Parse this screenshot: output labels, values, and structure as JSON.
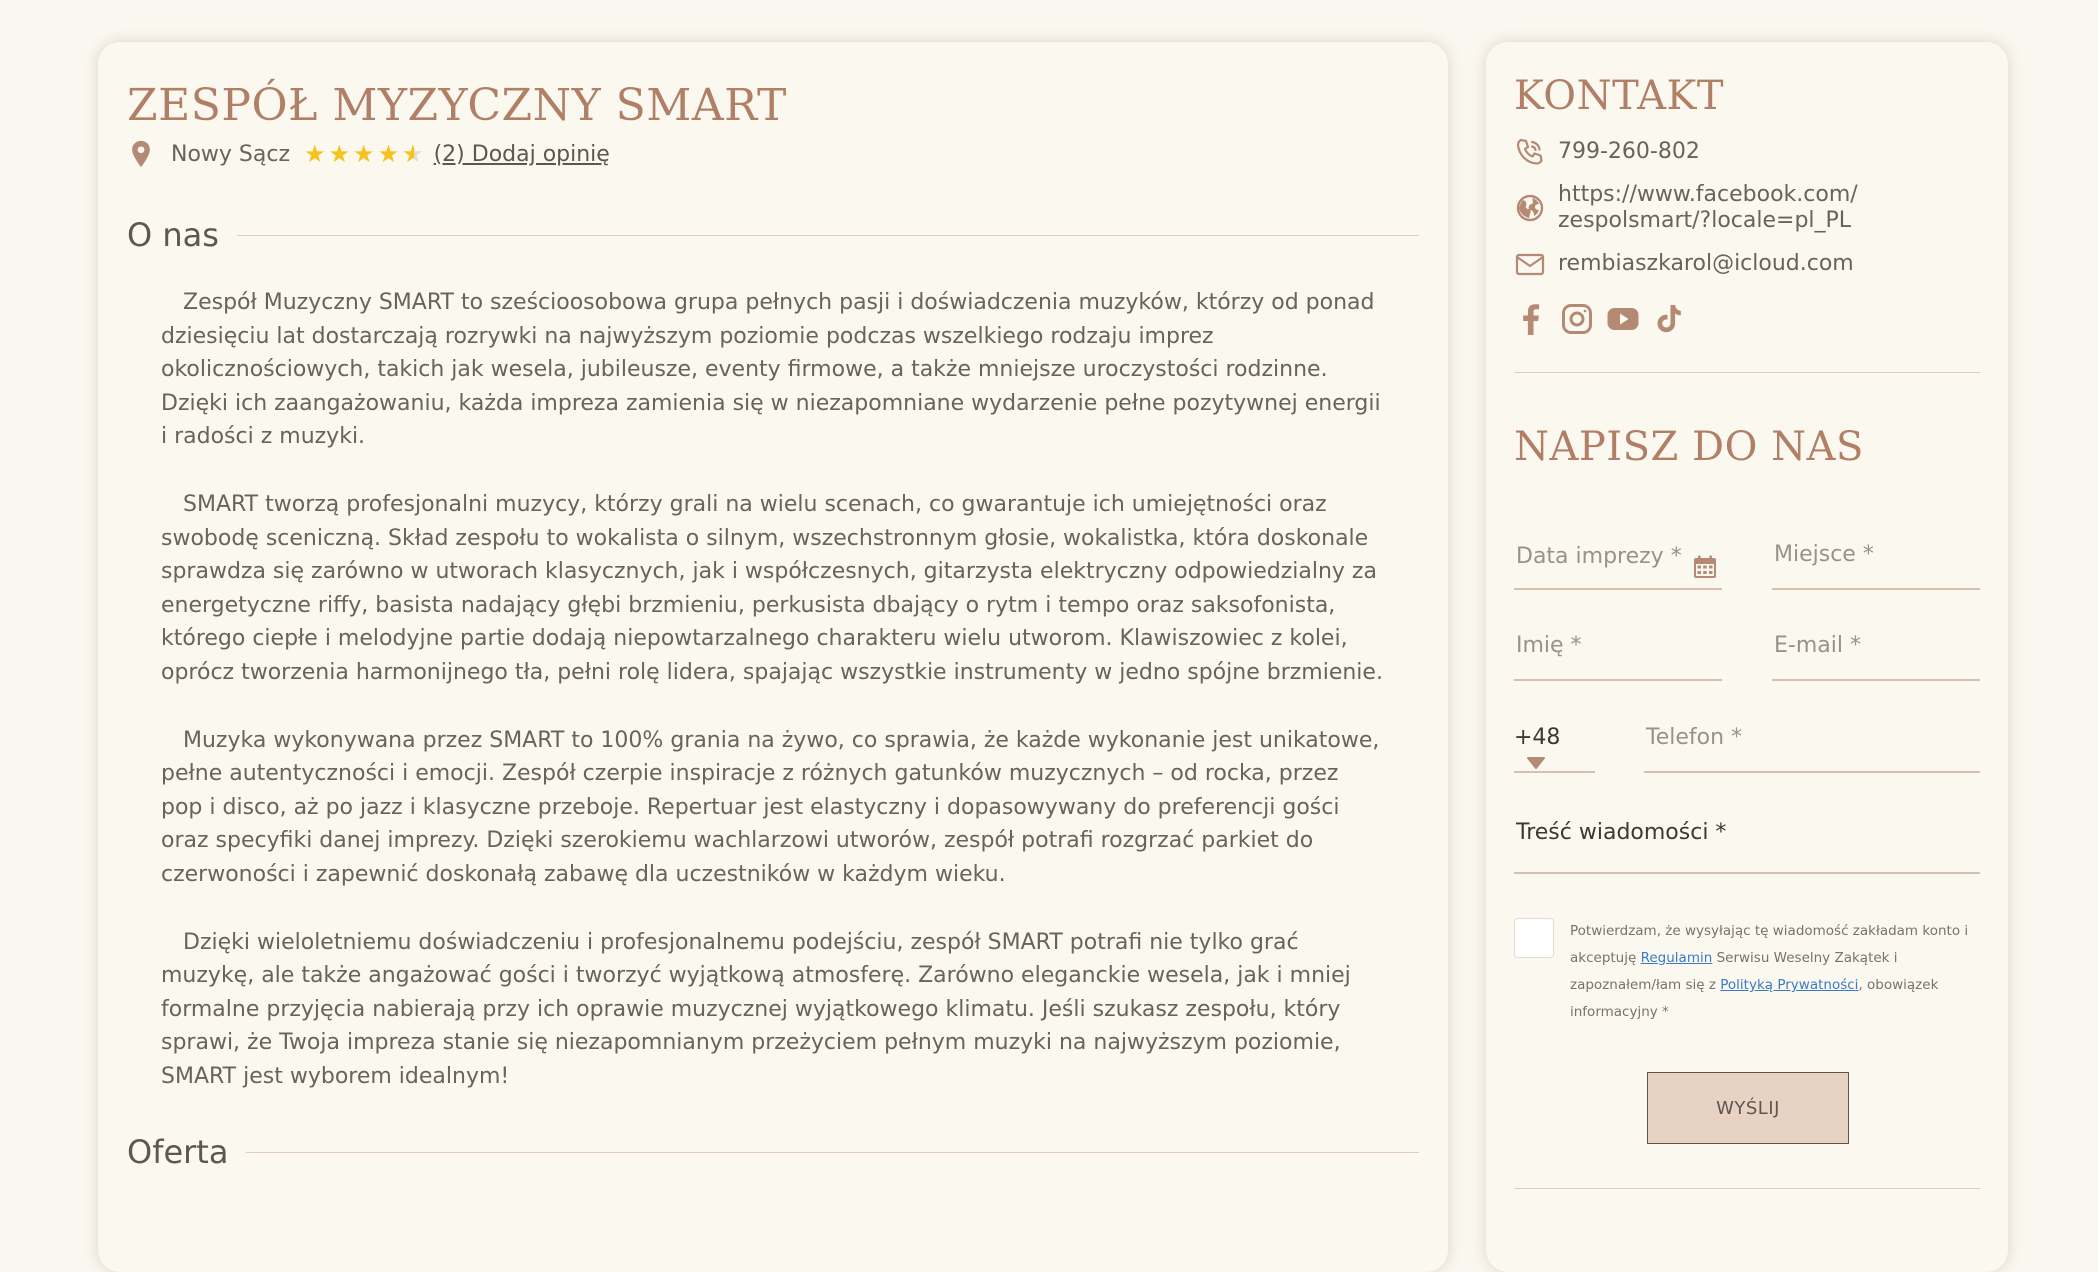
{
  "band": {
    "title": "ZESPÓŁ MYZYCZNY SMART",
    "city": "Nowy Sącz",
    "rating": 4.5,
    "rating_max": 5,
    "review_link": "(2) Dodaj opinię"
  },
  "about": {
    "heading": "O nas",
    "paragraphs": [
      "Zespół Muzyczny SMART to sześcioosobowa grupa pełnych pasji i doświadczenia muzyków, którzy od ponad dziesięciu lat dostarczają rozrywki na najwyższym poziomie podczas wszelkiego rodzaju imprez okolicznościowych, takich jak wesela, jubileusze, eventy firmowe, a także mniejsze uroczystości rodzinne. Dzięki ich zaangażowaniu, każda impreza zamienia się w niezapomniane wydarzenie pełne pozytywnej energii i radości z muzyki.",
      "SMART tworzą profesjonalni muzycy, którzy grali na wielu scenach, co gwarantuje ich umiejętności oraz swobodę sceniczną. Skład zespołu to wokalista o silnym, wszechstronnym głosie, wokalistka, która doskonale sprawdza się zarówno w utworach klasycznych, jak i współczesnych, gitarzysta elektryczny odpowiedzialny za energetyczne riffy, basista nadający głębi brzmieniu, perkusista dbający o rytm i tempo oraz saksofonista, którego ciepłe i melodyjne partie dodają niepowtarzalnego charakteru wielu utworom. Klawiszowiec z kolei, oprócz tworzenia harmonijnego tła, pełni rolę lidera, spajając wszystkie instrumenty w jedno spójne brzmienie.",
      "Muzyka wykonywana przez SMART to 100% grania na żywo, co sprawia, że każde wykonanie jest unikatowe, pełne autentyczności i emocji. Zespół czerpie inspiracje z różnych gatunków muzycznych – od rocka, przez pop i disco, aż po jazz i klasyczne przeboje. Repertuar jest elastyczny i dopasowywany do preferencji gości oraz specyfiki danej imprezy. Dzięki szerokiemu wachlarzowi utworów, zespół potrafi rozgrzać parkiet do czerwoności i zapewnić doskonałą zabawę dla uczestników w każdym wieku.",
      "Dzięki wieloletniemu doświadczeniu i profesjonalnemu podejściu, zespół SMART potrafi nie tylko grać muzykę, ale także angażować gości i tworzyć wyjątkową atmosferę. Zarówno eleganckie wesela, jak i mniej formalne przyjęcia nabierają przy ich oprawie muzycznej wyjątkowego klimatu. Jeśli szukasz zespołu, który sprawi, że Twoja impreza stanie się niezapomnianym przeżyciem pełnym muzyki na najwyższym poziomie, SMART jest wyborem idealnym!"
    ]
  },
  "offer": {
    "heading": "Oferta"
  },
  "contact": {
    "heading": "KONTAKT",
    "phone": "799-260-802",
    "website_line1": "https://www.facebook.com/",
    "website_line2": "zespolsmart/?locale=pl_PL",
    "email": "rembiaszkarol@icloud.com",
    "socials": [
      "facebook-icon",
      "instagram-icon",
      "youtube-icon",
      "tiktok-icon"
    ]
  },
  "form": {
    "heading": "NAPISZ DO NAS",
    "date_placeholder": "Data imprezy *",
    "place_placeholder": "Miejsce *",
    "name_placeholder": "Imię *",
    "email_placeholder": "E-mail *",
    "country_code": "+48",
    "phone_placeholder": "Telefon *",
    "message_label": "Treść wiadomości *",
    "consent_part1": "Potwierdzam, że wysyłając tę wiadomość zakładam konto i akceptuję ",
    "consent_link1": "Regulamin",
    "consent_part2": " Serwisu Weselny Zakątek i zapoznałem/łam się z ",
    "consent_link2": "Polityką Prywatności",
    "consent_part3": ", obowiązek informacyjny *",
    "submit_label": "WYŚLIJ"
  },
  "colors": {
    "accent": "#b07f66",
    "background": "#faf7f0",
    "star": "#f6c21b",
    "button": "#e8d2c4",
    "link": "#3b7ac6"
  }
}
